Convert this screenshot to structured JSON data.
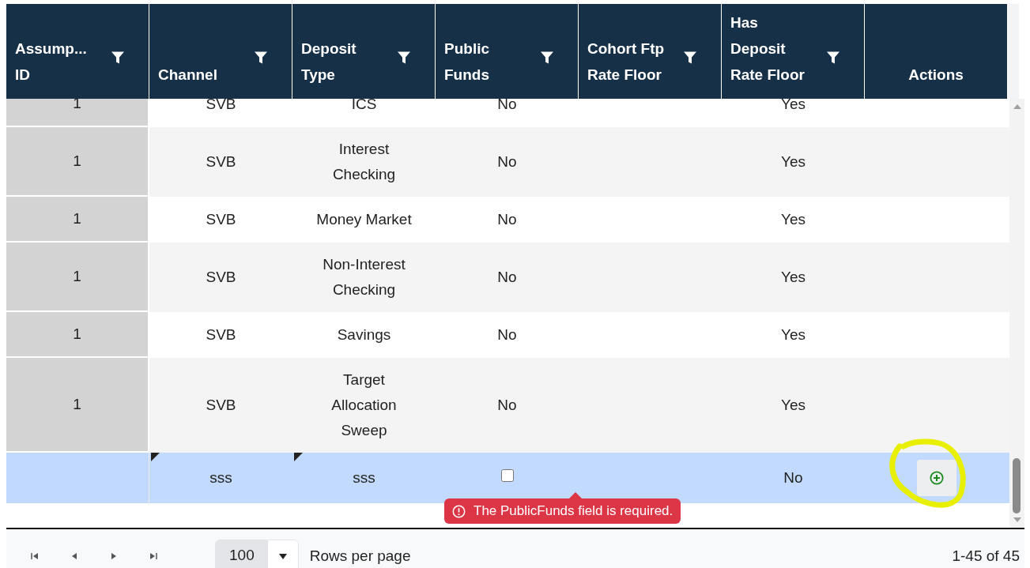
{
  "columns": [
    {
      "label": "Assump... ID",
      "filter": true
    },
    {
      "label": "Channel",
      "filter": true
    },
    {
      "label": "Deposit Type",
      "filter": true
    },
    {
      "label": "Public Funds",
      "filter": true
    },
    {
      "label": "Cohort Ftp Rate Floor",
      "filter": true
    },
    {
      "label": "Has Deposit Rate Floor",
      "filter": true
    },
    {
      "label": "Actions",
      "filter": false
    }
  ],
  "rows": [
    {
      "assumption_id": "1",
      "channel": "SVB",
      "deposit_type": "ICS",
      "public_funds": "No",
      "has_deposit_rate_floor": "Yes"
    },
    {
      "assumption_id": "1",
      "channel": "SVB",
      "deposit_type": "Interest Checking",
      "public_funds": "No",
      "has_deposit_rate_floor": "Yes"
    },
    {
      "assumption_id": "1",
      "channel": "SVB",
      "deposit_type": "Money Market",
      "public_funds": "No",
      "has_deposit_rate_floor": "Yes"
    },
    {
      "assumption_id": "1",
      "channel": "SVB",
      "deposit_type": "Non-Interest Checking",
      "public_funds": "No",
      "has_deposit_rate_floor": "Yes"
    },
    {
      "assumption_id": "1",
      "channel": "SVB",
      "deposit_type": "Savings",
      "public_funds": "No",
      "has_deposit_rate_floor": "Yes"
    },
    {
      "assumption_id": "1",
      "channel": "SVB",
      "deposit_type": "Target Allocation Sweep",
      "public_funds": "No",
      "has_deposit_rate_floor": "Yes"
    }
  ],
  "new_row": {
    "selected": true,
    "channel": "sss",
    "channel_edited": true,
    "deposit_type": "sss",
    "deposit_type_edited": true,
    "public_funds_checked": false,
    "has_deposit_rate_floor": "No",
    "error": "The PublicFunds field is required."
  },
  "pager": {
    "page_size": "100",
    "rows_per_page_label": "Rows per page",
    "range": "1-45 of 45"
  }
}
